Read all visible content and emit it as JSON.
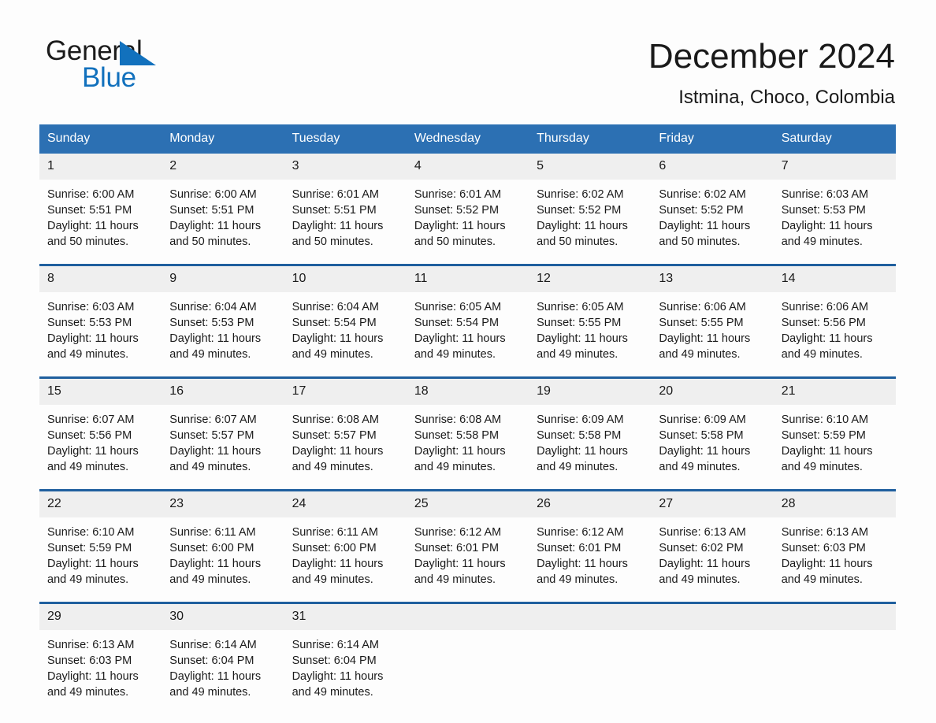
{
  "brand": {
    "name_part1": "General",
    "name_part2": "Blue",
    "accent_color": "#1271bd"
  },
  "header": {
    "month_title": "December 2024",
    "location": "Istmina, Choco, Colombia"
  },
  "colors": {
    "header_blue": "#2c70b3",
    "row_divider_blue": "#1f5f9e",
    "daynum_band": "#efefef",
    "page_background": "#fdfdfd"
  },
  "calendar": {
    "weekday_headers": [
      "Sunday",
      "Monday",
      "Tuesday",
      "Wednesday",
      "Thursday",
      "Friday",
      "Saturday"
    ],
    "weeks": [
      [
        {
          "day": "1",
          "sunrise": "Sunrise: 6:00 AM",
          "sunset": "Sunset: 5:51 PM",
          "daylight_line1": "Daylight: 11 hours",
          "daylight_line2": "and 50 minutes."
        },
        {
          "day": "2",
          "sunrise": "Sunrise: 6:00 AM",
          "sunset": "Sunset: 5:51 PM",
          "daylight_line1": "Daylight: 11 hours",
          "daylight_line2": "and 50 minutes."
        },
        {
          "day": "3",
          "sunrise": "Sunrise: 6:01 AM",
          "sunset": "Sunset: 5:51 PM",
          "daylight_line1": "Daylight: 11 hours",
          "daylight_line2": "and 50 minutes."
        },
        {
          "day": "4",
          "sunrise": "Sunrise: 6:01 AM",
          "sunset": "Sunset: 5:52 PM",
          "daylight_line1": "Daylight: 11 hours",
          "daylight_line2": "and 50 minutes."
        },
        {
          "day": "5",
          "sunrise": "Sunrise: 6:02 AM",
          "sunset": "Sunset: 5:52 PM",
          "daylight_line1": "Daylight: 11 hours",
          "daylight_line2": "and 50 minutes."
        },
        {
          "day": "6",
          "sunrise": "Sunrise: 6:02 AM",
          "sunset": "Sunset: 5:52 PM",
          "daylight_line1": "Daylight: 11 hours",
          "daylight_line2": "and 50 minutes."
        },
        {
          "day": "7",
          "sunrise": "Sunrise: 6:03 AM",
          "sunset": "Sunset: 5:53 PM",
          "daylight_line1": "Daylight: 11 hours",
          "daylight_line2": "and 49 minutes."
        }
      ],
      [
        {
          "day": "8",
          "sunrise": "Sunrise: 6:03 AM",
          "sunset": "Sunset: 5:53 PM",
          "daylight_line1": "Daylight: 11 hours",
          "daylight_line2": "and 49 minutes."
        },
        {
          "day": "9",
          "sunrise": "Sunrise: 6:04 AM",
          "sunset": "Sunset: 5:53 PM",
          "daylight_line1": "Daylight: 11 hours",
          "daylight_line2": "and 49 minutes."
        },
        {
          "day": "10",
          "sunrise": "Sunrise: 6:04 AM",
          "sunset": "Sunset: 5:54 PM",
          "daylight_line1": "Daylight: 11 hours",
          "daylight_line2": "and 49 minutes."
        },
        {
          "day": "11",
          "sunrise": "Sunrise: 6:05 AM",
          "sunset": "Sunset: 5:54 PM",
          "daylight_line1": "Daylight: 11 hours",
          "daylight_line2": "and 49 minutes."
        },
        {
          "day": "12",
          "sunrise": "Sunrise: 6:05 AM",
          "sunset": "Sunset: 5:55 PM",
          "daylight_line1": "Daylight: 11 hours",
          "daylight_line2": "and 49 minutes."
        },
        {
          "day": "13",
          "sunrise": "Sunrise: 6:06 AM",
          "sunset": "Sunset: 5:55 PM",
          "daylight_line1": "Daylight: 11 hours",
          "daylight_line2": "and 49 minutes."
        },
        {
          "day": "14",
          "sunrise": "Sunrise: 6:06 AM",
          "sunset": "Sunset: 5:56 PM",
          "daylight_line1": "Daylight: 11 hours",
          "daylight_line2": "and 49 minutes."
        }
      ],
      [
        {
          "day": "15",
          "sunrise": "Sunrise: 6:07 AM",
          "sunset": "Sunset: 5:56 PM",
          "daylight_line1": "Daylight: 11 hours",
          "daylight_line2": "and 49 minutes."
        },
        {
          "day": "16",
          "sunrise": "Sunrise: 6:07 AM",
          "sunset": "Sunset: 5:57 PM",
          "daylight_line1": "Daylight: 11 hours",
          "daylight_line2": "and 49 minutes."
        },
        {
          "day": "17",
          "sunrise": "Sunrise: 6:08 AM",
          "sunset": "Sunset: 5:57 PM",
          "daylight_line1": "Daylight: 11 hours",
          "daylight_line2": "and 49 minutes."
        },
        {
          "day": "18",
          "sunrise": "Sunrise: 6:08 AM",
          "sunset": "Sunset: 5:58 PM",
          "daylight_line1": "Daylight: 11 hours",
          "daylight_line2": "and 49 minutes."
        },
        {
          "day": "19",
          "sunrise": "Sunrise: 6:09 AM",
          "sunset": "Sunset: 5:58 PM",
          "daylight_line1": "Daylight: 11 hours",
          "daylight_line2": "and 49 minutes."
        },
        {
          "day": "20",
          "sunrise": "Sunrise: 6:09 AM",
          "sunset": "Sunset: 5:58 PM",
          "daylight_line1": "Daylight: 11 hours",
          "daylight_line2": "and 49 minutes."
        },
        {
          "day": "21",
          "sunrise": "Sunrise: 6:10 AM",
          "sunset": "Sunset: 5:59 PM",
          "daylight_line1": "Daylight: 11 hours",
          "daylight_line2": "and 49 minutes."
        }
      ],
      [
        {
          "day": "22",
          "sunrise": "Sunrise: 6:10 AM",
          "sunset": "Sunset: 5:59 PM",
          "daylight_line1": "Daylight: 11 hours",
          "daylight_line2": "and 49 minutes."
        },
        {
          "day": "23",
          "sunrise": "Sunrise: 6:11 AM",
          "sunset": "Sunset: 6:00 PM",
          "daylight_line1": "Daylight: 11 hours",
          "daylight_line2": "and 49 minutes."
        },
        {
          "day": "24",
          "sunrise": "Sunrise: 6:11 AM",
          "sunset": "Sunset: 6:00 PM",
          "daylight_line1": "Daylight: 11 hours",
          "daylight_line2": "and 49 minutes."
        },
        {
          "day": "25",
          "sunrise": "Sunrise: 6:12 AM",
          "sunset": "Sunset: 6:01 PM",
          "daylight_line1": "Daylight: 11 hours",
          "daylight_line2": "and 49 minutes."
        },
        {
          "day": "26",
          "sunrise": "Sunrise: 6:12 AM",
          "sunset": "Sunset: 6:01 PM",
          "daylight_line1": "Daylight: 11 hours",
          "daylight_line2": "and 49 minutes."
        },
        {
          "day": "27",
          "sunrise": "Sunrise: 6:13 AM",
          "sunset": "Sunset: 6:02 PM",
          "daylight_line1": "Daylight: 11 hours",
          "daylight_line2": "and 49 minutes."
        },
        {
          "day": "28",
          "sunrise": "Sunrise: 6:13 AM",
          "sunset": "Sunset: 6:03 PM",
          "daylight_line1": "Daylight: 11 hours",
          "daylight_line2": "and 49 minutes."
        }
      ],
      [
        {
          "day": "29",
          "sunrise": "Sunrise: 6:13 AM",
          "sunset": "Sunset: 6:03 PM",
          "daylight_line1": "Daylight: 11 hours",
          "daylight_line2": "and 49 minutes."
        },
        {
          "day": "30",
          "sunrise": "Sunrise: 6:14 AM",
          "sunset": "Sunset: 6:04 PM",
          "daylight_line1": "Daylight: 11 hours",
          "daylight_line2": "and 49 minutes."
        },
        {
          "day": "31",
          "sunrise": "Sunrise: 6:14 AM",
          "sunset": "Sunset: 6:04 PM",
          "daylight_line1": "Daylight: 11 hours",
          "daylight_line2": "and 49 minutes."
        },
        {
          "day": "",
          "sunrise": "",
          "sunset": "",
          "daylight_line1": "",
          "daylight_line2": ""
        },
        {
          "day": "",
          "sunrise": "",
          "sunset": "",
          "daylight_line1": "",
          "daylight_line2": ""
        },
        {
          "day": "",
          "sunrise": "",
          "sunset": "",
          "daylight_line1": "",
          "daylight_line2": ""
        },
        {
          "day": "",
          "sunrise": "",
          "sunset": "",
          "daylight_line1": "",
          "daylight_line2": ""
        }
      ]
    ]
  }
}
